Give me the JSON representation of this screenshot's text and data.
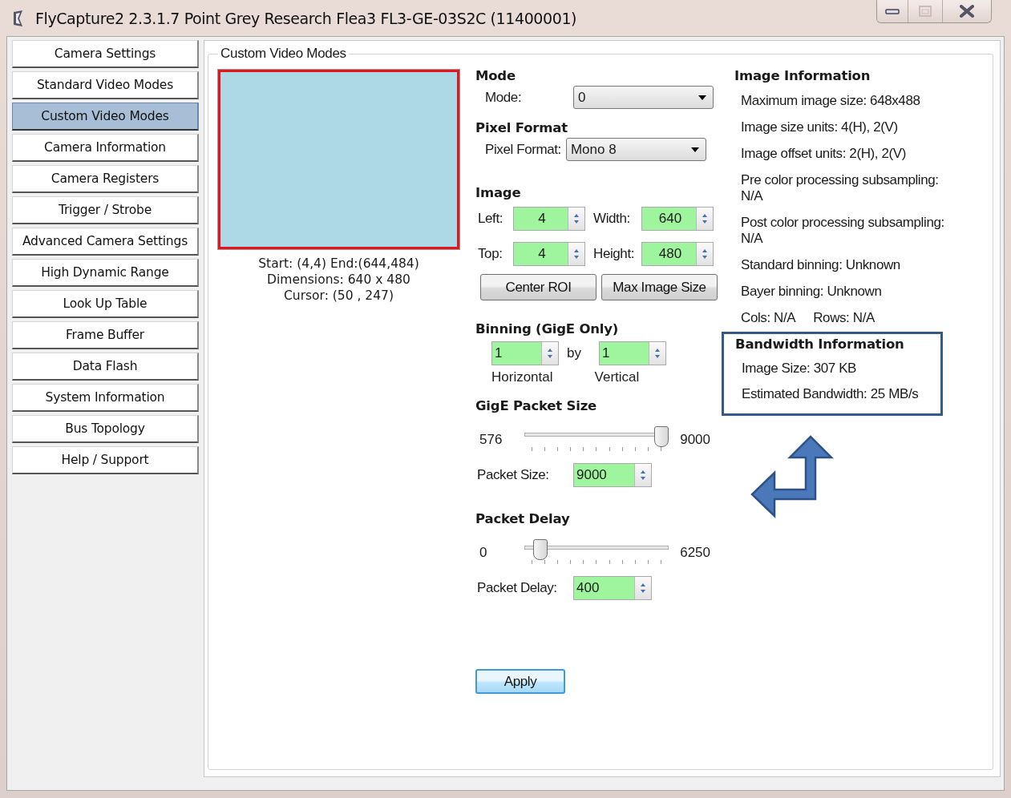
{
  "window": {
    "title": "FlyCapture2 2.3.1.7  Point Grey Research Flea3 FL3-GE-03S2C (11400001)"
  },
  "sidebar": {
    "items": [
      {
        "label": "Camera Settings",
        "selected": false
      },
      {
        "label": "Standard Video Modes",
        "selected": false
      },
      {
        "label": "Custom Video Modes",
        "selected": true
      },
      {
        "label": "Camera Information",
        "selected": false
      },
      {
        "label": "Camera Registers",
        "selected": false
      },
      {
        "label": "Trigger / Strobe",
        "selected": false
      },
      {
        "label": "Advanced Camera Settings",
        "selected": false
      },
      {
        "label": "High Dynamic Range",
        "selected": false
      },
      {
        "label": "Look Up Table",
        "selected": false
      },
      {
        "label": "Frame Buffer",
        "selected": false
      },
      {
        "label": "Data Flash",
        "selected": false
      },
      {
        "label": "System Information",
        "selected": false
      },
      {
        "label": "Bus Topology",
        "selected": false
      },
      {
        "label": "Help / Support",
        "selected": false
      }
    ]
  },
  "group": {
    "title": "Custom Video Modes"
  },
  "preview": {
    "roi_info": [
      "Start: (4,4) End:(644,484)",
      "Dimensions: 640 x 480",
      "Cursor: (50 , 247)"
    ]
  },
  "mode": {
    "heading": "Mode",
    "label": "Mode:",
    "value": "0"
  },
  "pixel_format": {
    "heading": "Pixel Format",
    "label": "Pixel Format:",
    "value": "Mono 8"
  },
  "image": {
    "heading": "Image",
    "fields": [
      {
        "label": "Left:",
        "value": "4"
      },
      {
        "label": "Width:",
        "value": "640"
      },
      {
        "label": "Top:",
        "value": "4"
      },
      {
        "label": "Height:",
        "value": "480"
      }
    ],
    "buttons": [
      "Center ROI",
      "Max Image Size"
    ]
  },
  "binning": {
    "heading": "Binning (GigE Only)",
    "horizontal": {
      "value": "1",
      "caption": "Horizontal"
    },
    "separator": "by",
    "vertical": {
      "value": "1",
      "caption": "Vertical"
    }
  },
  "packet_size": {
    "heading": "GigE Packet Size",
    "min": "576",
    "max": "9000",
    "level": 1.0,
    "label": "Packet Size:",
    "value": "9000"
  },
  "packet_delay": {
    "heading": "Packet Delay",
    "min": "0",
    "max": "6250",
    "level": 0.07,
    "label": "Packet Delay:",
    "value": "400"
  },
  "apply_button": "Apply",
  "image_information": {
    "heading": "Image Information",
    "lines": [
      "Maximum image size: 648x488",
      "Image size units: 4(H), 2(V)",
      "Image offset units: 2(H), 2(V)",
      "Pre color processing subsampling: N/A",
      "Post color processing subsampling: N/A",
      "Standard binning: Unknown",
      "Bayer binning: Unknown"
    ],
    "cols": "Cols: N/A",
    "rows": "Rows: N/A"
  },
  "bandwidth_information": {
    "heading": "Bandwidth Information",
    "highlighted": true,
    "lines": [
      "Image Size: 307 KB",
      "Estimated Bandwidth: 25 MB/s"
    ]
  }
}
